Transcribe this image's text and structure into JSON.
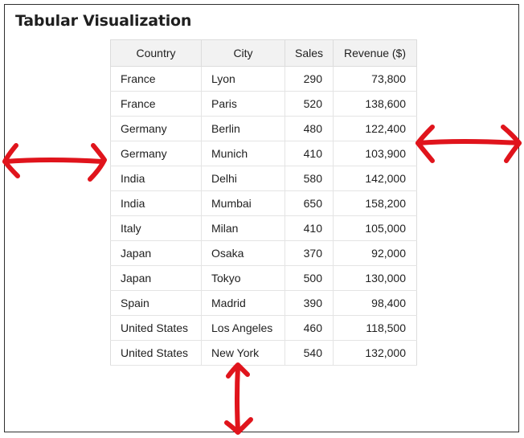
{
  "title": "Tabular Visualization",
  "table": {
    "columns": [
      "Country",
      "City",
      "Sales",
      "Revenue ($)"
    ],
    "rows": [
      [
        "France",
        "Lyon",
        "290",
        "73,800"
      ],
      [
        "France",
        "Paris",
        "520",
        "138,600"
      ],
      [
        "Germany",
        "Berlin",
        "480",
        "122,400"
      ],
      [
        "Germany",
        "Munich",
        "410",
        "103,900"
      ],
      [
        "India",
        "Delhi",
        "580",
        "142,000"
      ],
      [
        "India",
        "Mumbai",
        "650",
        "158,200"
      ],
      [
        "Italy",
        "Milan",
        "410",
        "105,000"
      ],
      [
        "Japan",
        "Osaka",
        "370",
        "92,000"
      ],
      [
        "Japan",
        "Tokyo",
        "500",
        "130,000"
      ],
      [
        "Spain",
        "Madrid",
        "390",
        "98,400"
      ],
      [
        "United States",
        "Los Angeles",
        "460",
        "118,500"
      ],
      [
        "United States",
        "New York",
        "540",
        "132,000"
      ]
    ]
  },
  "annotation_color": "#e0141c"
}
